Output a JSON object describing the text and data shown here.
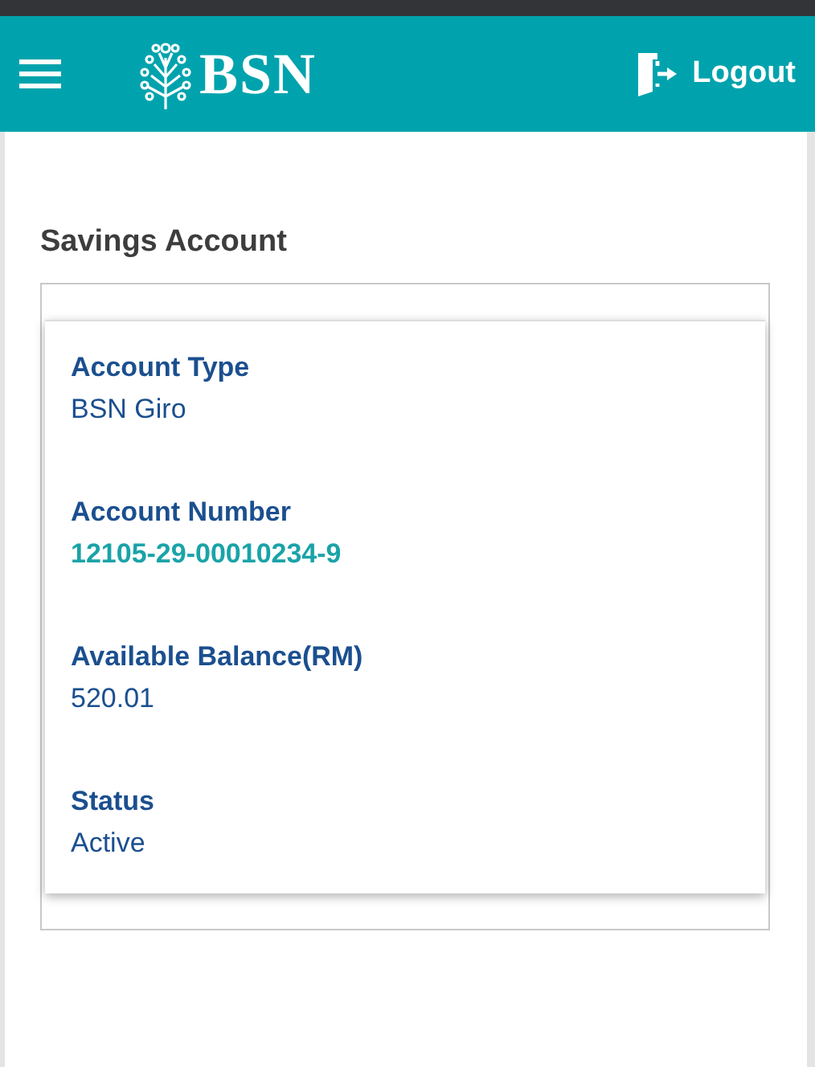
{
  "header": {
    "logo": "BSN",
    "logout": "Logout"
  },
  "section": {
    "title": "Savings Account"
  },
  "fields": [
    {
      "label": "Account Type",
      "value": "BSN Giro",
      "kind": "plain"
    },
    {
      "label": "Account Number",
      "value": "12105-29-00010234-9",
      "kind": "highlight"
    },
    {
      "label": "Available Balance(RM)",
      "value": "520.01",
      "kind": "plain"
    },
    {
      "label": "Status",
      "value": "Active",
      "kind": "plain"
    }
  ]
}
